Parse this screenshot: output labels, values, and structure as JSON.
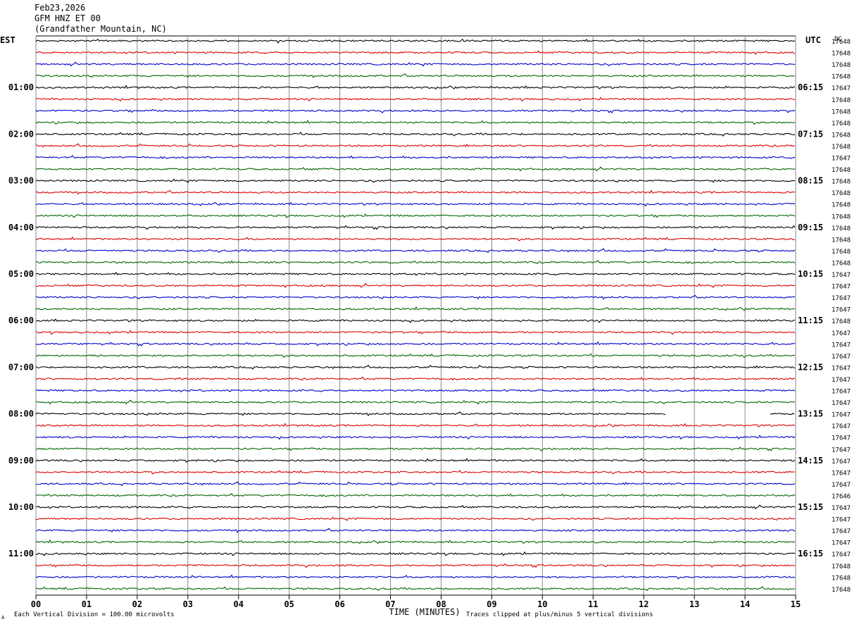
{
  "header": {
    "date": "Feb23,2026",
    "station": "GFM HNZ ET 00",
    "location": "(Grandfather Mountain, NC)"
  },
  "left_tz": "EST",
  "right_tz": "UTC",
  "dc_label": "DC",
  "footer": {
    "scale_note": "Each Vertical Division = 100.00 microvolts",
    "xlabel": "TIME (MINUTES)",
    "clip_note": "Traces clipped at plus/minus 5 vertical divisions",
    "corner_glyph": "A"
  },
  "colors": {
    "trace_cycle": [
      "#000000",
      "#dd0000",
      "#0000cc",
      "#006600"
    ],
    "grid": "#888888",
    "text": "#000000"
  },
  "chart_data": {
    "type": "line",
    "description_units": "helicorder traces, 15 minutes per line",
    "xlim": [
      0,
      15
    ],
    "x_ticks": [
      "00",
      "01",
      "02",
      "03",
      "04",
      "05",
      "06",
      "07",
      "08",
      "09",
      "10",
      "11",
      "12",
      "13",
      "14",
      "15"
    ],
    "left_hour_labels": [
      "01:00",
      "02:00",
      "03:00",
      "04:00",
      "05:00",
      "06:00",
      "07:00",
      "08:00",
      "09:00",
      "10:00",
      "11:00"
    ],
    "right_hour_labels": [
      "06:15",
      "07:15",
      "08:15",
      "09:15",
      "10:15",
      "11:15",
      "12:15",
      "13:15",
      "14:15",
      "15:15",
      "16:15"
    ],
    "dc_offsets": [
      "17648",
      "17648",
      "17648",
      "17648",
      "17647",
      "17648",
      "17648",
      "17648",
      "17648",
      "17648",
      "17647",
      "17648",
      "17648",
      "17648",
      "17648",
      "17648",
      "17648",
      "17648",
      "17648",
      "17648",
      "17647",
      "17647",
      "17647",
      "17647",
      "17648",
      "17647",
      "17647",
      "17647",
      "17647",
      "17647",
      "17647",
      "17647",
      "17647",
      "17647",
      "17647",
      "17647",
      "17647",
      "17647",
      "17647",
      "17646",
      "17647",
      "17647",
      "17647",
      "17647",
      "17647",
      "17648",
      "17648",
      "17648"
    ],
    "gaps": [
      {
        "trace": 32,
        "from_min": 12.45,
        "to_min": 14.5
      }
    ]
  }
}
